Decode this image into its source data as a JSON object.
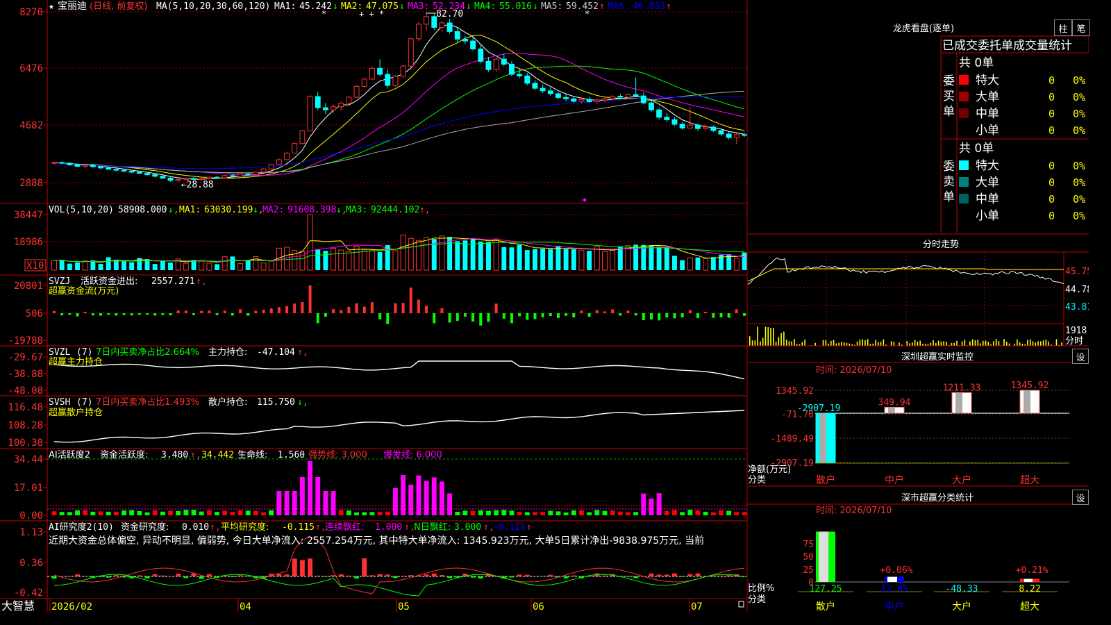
{
  "app": {
    "name": "大智慧",
    "title": "宝丽迪",
    "title_note": "(日线, 前复权)"
  },
  "colors": {
    "up": "#ff3232",
    "down": "#00ffff",
    "ma1": "#ffffff",
    "ma2": "#ffff00",
    "ma3": "#ff00ff",
    "ma4": "#00ff00",
    "ma5": "#aaaaaa",
    "ma6": "#0000ff",
    "grid": "#a00000",
    "frame": "#c00000"
  },
  "main": {
    "legend": {
      "ma_params": "MA(5,10,20,30,60,120)",
      "items": [
        {
          "label": "MA1:",
          "value": "45.242",
          "arrow": "↓",
          "color": "#ffffff"
        },
        {
          "label": "MA2:",
          "value": "47.075",
          "arrow": "↓",
          "color": "#ffff00"
        },
        {
          "label": "MA3:",
          "value": "52.234",
          "arrow": "↓",
          "color": "#ff00ff"
        },
        {
          "label": "MA4:",
          "value": "55.016",
          "arrow": "↓",
          "color": "#00ff00"
        },
        {
          "label": "MA5:",
          "value": "59.452",
          "arrow": "↑",
          "color": "#cccccc"
        },
        {
          "label": "MA6:",
          "value": "46.833",
          "arrow": "↑",
          "color": "#0000ff"
        }
      ]
    },
    "y_ticks": [
      "8270",
      "6476",
      "4682",
      "2888"
    ],
    "high_label": "82.70",
    "low_label": "28.88"
  },
  "vol": {
    "params": "VOL(5,10,20)",
    "value": "58908.000",
    "value_arrow": "↓",
    "items": [
      {
        "label": "MA1:",
        "value": "63030.199",
        "arrow": "↓",
        "color": "#ffff00"
      },
      {
        "label": "MA2:",
        "value": "91608.398",
        "arrow": "↓",
        "color": "#ff00ff"
      },
      {
        "label": "MA3:",
        "value": "92444.102",
        "arrow": "↑",
        "color": "#00ff00"
      }
    ],
    "y_ticks": [
      "38447",
      "18986"
    ],
    "unit": "X10"
  },
  "svzj": {
    "name": "SVZJ",
    "label": "活跃资金进出:",
    "value": "2557.271",
    "arrow": "↑,",
    "sub": "超赢资金流(万元)",
    "y_ticks": [
      "20801",
      "506",
      "-19788"
    ]
  },
  "svzl": {
    "name": "SVZL",
    "param": "(7)",
    "label1": "7日内买卖净占比2.664%",
    "label2": "主力持仓:",
    "value": "-47.104",
    "arrow": "↑,",
    "sub": "超赢主力持仓",
    "y_ticks": [
      "-29.67",
      "-38.88",
      "-48.08"
    ]
  },
  "svsh": {
    "name": "SVSH",
    "param": "(7)",
    "label1": "7日内买卖净占比1.493%",
    "label2": "散户持仓:",
    "value": "115.750",
    "arrow": "↓,",
    "sub": "超赢散户持仓",
    "y_ticks": [
      "116.48",
      "108.28",
      "100.38"
    ]
  },
  "ai_act": {
    "name": "AI活跃度2",
    "label": "资金活跃度:",
    "value": "3.480",
    "value2": "34.442",
    "life_label": "生命线:",
    "life": "1.560",
    "strong": "强势线: 3.000",
    "burst": "爆发线: 6.000",
    "y_ticks": [
      "34.44",
      "17.01",
      "0.00"
    ]
  },
  "ai_res": {
    "name": "AI研究度2(10)",
    "label": "资金研究度:",
    "value": "0.010",
    "avg_label": "平均研究度:",
    "avg": "-0.115",
    "red_label": "连续飘红:",
    "red": "1.000",
    "n_label": "N日飘红:",
    "n": "3.000",
    "last": "-0.115",
    "comment": "近期大资金总体偏空, 异动不明显, 偏弱势, 今日大单净流入: 2557.254万元, 其中特大单净流入: 1345.923万元, 大单5日累计净出-9838.975万元, 当前",
    "y_ticks": [
      "1.13",
      "0.36",
      "-0.42"
    ]
  },
  "x_axis": [
    "2026/02",
    "04",
    "05",
    "06",
    "07"
  ],
  "right": {
    "lhb": {
      "title": "龙虎看盘(逐单)",
      "btn1": "柱",
      "btn2": "笔",
      "header": "已成交委托单成交量统计",
      "buy": {
        "side": "委买单",
        "total": "共 0单",
        "rows": [
          {
            "label": "特大",
            "count": "0",
            "pct": "0%",
            "color": "#ff0000"
          },
          {
            "label": "大单",
            "count": "0",
            "pct": "0%",
            "color": "#a00000"
          },
          {
            "label": "中单",
            "count": "0",
            "pct": "0%",
            "color": "#700000"
          },
          {
            "label": "小单",
            "count": "0",
            "pct": "0%",
            "color": "#000000"
          }
        ]
      },
      "sell": {
        "side": "委卖单",
        "total": "共 0单",
        "rows": [
          {
            "label": "特大",
            "count": "0",
            "pct": "0%",
            "color": "#00ffff"
          },
          {
            "label": "大单",
            "count": "0",
            "pct": "0%",
            "color": "#008080"
          },
          {
            "label": "中单",
            "count": "0",
            "pct": "0%",
            "color": "#006060"
          },
          {
            "label": "小单",
            "count": "0",
            "pct": "0%",
            "color": "#000000"
          }
        ]
      }
    },
    "intraday": {
      "title": "分时走势",
      "price_ticks": [
        "45.75",
        "44.78",
        "43.81"
      ],
      "vol_tick": "1918",
      "vol_unit": "分时"
    },
    "monitor": {
      "title": "深圳超赢实时监控",
      "settings": "设",
      "time_label": "时间: 2026/07/10",
      "y_ticks": [
        "1345.92",
        "-71.70",
        "-1489.49",
        "-2907.19"
      ],
      "y_unit_1": "净额(万元)",
      "y_unit_2": "分类",
      "bars": [
        {
          "cat": "散户",
          "value": -2907.19,
          "label": "-2907.19"
        },
        {
          "cat": "中户",
          "value": 349.94,
          "label": "349.94"
        },
        {
          "cat": "大户",
          "value": 1211.33,
          "label": "1211.33"
        },
        {
          "cat": "超大",
          "value": 1345.92,
          "label": "1345.92"
        }
      ]
    },
    "classify": {
      "title": "深市超赢分类统计",
      "settings": "设",
      "time_label": "时间: 2026/07/10",
      "y_ticks": [
        "75",
        "50",
        "25",
        "0"
      ],
      "y_unit_1": "比例%",
      "y_unit_2": "分类",
      "bars": [
        {
          "cat": "散户",
          "value": 98,
          "top": "",
          "bottom": "127.25"
        },
        {
          "cat": "中户",
          "value": 10,
          "top": "+0.06%",
          "bottom": "12.85"
        },
        {
          "cat": "大户",
          "value": 0,
          "top": "",
          "bottom": "-48.33"
        },
        {
          "cat": "超大",
          "value": 6,
          "top": "+0.21%",
          "bottom": "8.22"
        }
      ]
    }
  },
  "chart_data": {
    "type": "candlestick",
    "title": "宝丽迪",
    "ylim": [
      28.88,
      82.7
    ],
    "high": 82.7,
    "low": 28.88,
    "candles": [
      [
        35,
        35.5,
        34.5,
        35.2
      ],
      [
        35.2,
        35.6,
        34.8,
        35.0
      ],
      [
        35.0,
        35.3,
        34.2,
        34.5
      ],
      [
        34.5,
        34.9,
        33.8,
        34.0
      ],
      [
        34.0,
        34.6,
        33.5,
        34.4
      ],
      [
        34.4,
        34.8,
        33.6,
        33.9
      ],
      [
        33.9,
        34.2,
        33.2,
        33.5
      ],
      [
        33.5,
        33.8,
        32.9,
        33.1
      ],
      [
        33.1,
        33.5,
        32.4,
        32.8
      ],
      [
        32.8,
        33.2,
        32.1,
        32.5
      ],
      [
        32.5,
        32.9,
        31.8,
        32.2
      ],
      [
        32.2,
        32.5,
        31.5,
        31.8
      ],
      [
        31.8,
        32.2,
        31.0,
        31.4
      ],
      [
        31.4,
        31.8,
        30.5,
        30.9
      ],
      [
        30.9,
        31.2,
        30.0,
        30.3
      ],
      [
        30.3,
        30.7,
        29.2,
        29.6
      ],
      [
        29.6,
        30.2,
        28.88,
        29.9
      ],
      [
        29.9,
        30.5,
        29.5,
        30.2
      ],
      [
        30.2,
        30.6,
        29.6,
        29.9
      ],
      [
        29.9,
        30.4,
        29.4,
        30.1
      ],
      [
        30.1,
        30.8,
        29.8,
        30.6
      ],
      [
        30.6,
        31.0,
        30.1,
        30.4
      ],
      [
        30.4,
        31.3,
        30.2,
        31.1
      ],
      [
        31.1,
        31.6,
        30.7,
        30.9
      ],
      [
        30.9,
        31.8,
        30.7,
        31.6
      ],
      [
        31.6,
        32.0,
        31.1,
        31.4
      ],
      [
        31.4,
        32.4,
        31.2,
        32.2
      ],
      [
        32.2,
        33.4,
        32.0,
        33.2
      ],
      [
        33.2,
        34.8,
        33.0,
        34.6
      ],
      [
        34.6,
        36.4,
        34.4,
        36.1
      ],
      [
        36.1,
        38.5,
        35.9,
        38.2
      ],
      [
        38.2,
        41.5,
        38.0,
        41.2
      ],
      [
        41.2,
        45.5,
        41.0,
        45.2
      ],
      [
        45.2,
        56.5,
        45.0,
        56.0
      ],
      [
        56.0,
        57.5,
        51.8,
        52.5
      ],
      [
        52.5,
        54.0,
        50.5,
        51.8
      ],
      [
        51.8,
        53.5,
        50.8,
        52.8
      ],
      [
        52.8,
        54.5,
        51.5,
        53.9
      ],
      [
        53.9,
        56.2,
        53.2,
        55.8
      ],
      [
        55.8,
        59.5,
        55.5,
        59.2
      ],
      [
        59.2,
        62.0,
        58.8,
        61.5
      ],
      [
        61.5,
        65.5,
        61.0,
        64.9
      ],
      [
        64.9,
        67.8,
        62.5,
        63.0
      ],
      [
        63.0,
        64.5,
        58.5,
        59.5
      ],
      [
        59.5,
        62.8,
        59.0,
        62.4
      ],
      [
        62.4,
        66.0,
        61.8,
        65.6
      ],
      [
        65.6,
        74.5,
        65.2,
        74.2
      ],
      [
        74.2,
        79.5,
        73.5,
        78.8
      ],
      [
        78.8,
        82.7,
        76.8,
        81.2
      ],
      [
        81.2,
        82.0,
        77.0,
        77.8
      ],
      [
        77.8,
        79.8,
        76.5,
        79.2
      ],
      [
        79.2,
        80.5,
        75.8,
        76.5
      ],
      [
        76.5,
        77.5,
        73.2,
        74.1
      ],
      [
        74.1,
        75.0,
        72.6,
        73.5
      ],
      [
        73.5,
        74.8,
        70.5,
        71.0
      ],
      [
        71.0,
        72.2,
        66.5,
        67.1
      ],
      [
        67.1,
        68.5,
        63.8,
        64.5
      ],
      [
        64.5,
        68.3,
        63.8,
        67.8
      ],
      [
        67.8,
        69.5,
        65.5,
        66.2
      ],
      [
        66.2,
        67.2,
        62.5,
        63.0
      ],
      [
        63.0,
        64.8,
        61.8,
        62.5
      ],
      [
        62.5,
        63.5,
        59.6,
        60.2
      ],
      [
        60.2,
        61.2,
        58.1,
        58.6
      ],
      [
        58.6,
        59.8,
        57.1,
        57.8
      ],
      [
        57.8,
        58.9,
        56.3,
        56.9
      ],
      [
        56.9,
        57.5,
        55.2,
        55.7
      ],
      [
        55.7,
        56.8,
        54.6,
        55.3
      ],
      [
        55.3,
        56.2,
        54.0,
        54.5
      ],
      [
        54.5,
        55.8,
        53.8,
        55.1
      ],
      [
        55.1,
        55.9,
        54.1,
        54.4
      ],
      [
        54.4,
        55.5,
        53.6,
        54.9
      ],
      [
        54.9,
        55.8,
        54.1,
        55.3
      ],
      [
        55.3,
        56.5,
        54.8,
        56.1
      ],
      [
        56.1,
        56.9,
        55.3,
        55.8
      ],
      [
        55.8,
        57.0,
        55.2,
        56.6
      ],
      [
        56.6,
        62.0,
        55.8,
        56.2
      ],
      [
        56.2,
        57.3,
        53.5,
        54.0
      ],
      [
        54.0,
        54.8,
        51.2,
        51.8
      ],
      [
        51.8,
        52.5,
        48.8,
        49.5
      ],
      [
        49.5,
        50.8,
        48.1,
        48.7
      ],
      [
        48.7,
        49.5,
        46.8,
        47.3
      ],
      [
        47.3,
        48.0,
        45.5,
        46.1
      ],
      [
        46.1,
        52.5,
        45.8,
        47.0
      ],
      [
        47.0,
        47.5,
        45.2,
        45.9
      ],
      [
        45.9,
        47.2,
        45.1,
        46.4
      ],
      [
        46.4,
        46.9,
        44.8,
        45.3
      ],
      [
        45.3,
        45.9,
        43.6,
        44.2
      ],
      [
        44.2,
        44.8,
        42.5,
        43.1
      ],
      [
        43.1,
        44.5,
        41.0,
        44.0
      ],
      [
        44.0,
        44.6,
        43.3,
        43.8
      ]
    ]
  }
}
